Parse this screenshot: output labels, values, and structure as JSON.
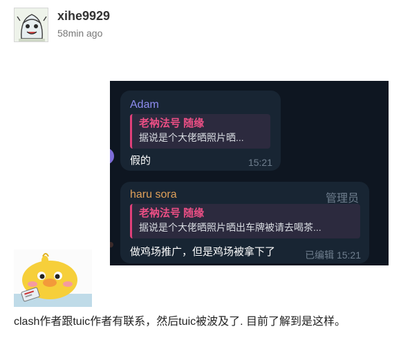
{
  "post": {
    "username": "xihe9929",
    "time_ago": "58min ago",
    "comment": "clash作者跟tuic作者有联系，然后tuic被波及了. 目前了解到是这样。"
  },
  "screenshot": {
    "messages": [
      {
        "sender": "Adam",
        "quote_name": "老衲法号 随缘",
        "quote_text": "据说是个大佬晒照片晒...",
        "text": "假的",
        "time": "15:21"
      },
      {
        "sender": "haru sora",
        "role": "管理员",
        "quote_name": "老衲法号 随缘",
        "quote_text": "据说是个大佬晒照片晒出车牌被请去喝茶...",
        "text": "做鸡场推广，但是鸡场被拿下了",
        "time": "已编辑 15:21"
      }
    ]
  },
  "colors": {
    "chat_bg": "#0e1621",
    "bubble": "#182533",
    "sender_1": "#8e8cf0",
    "sender_2": "#e0a15a",
    "quote_accent": "#e0407a"
  }
}
